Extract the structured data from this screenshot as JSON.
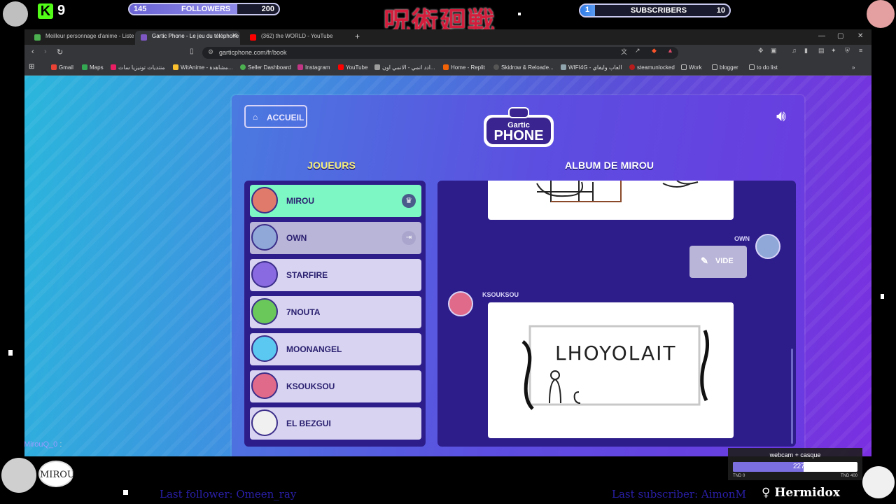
{
  "overlay": {
    "kick_count": "9",
    "followers": {
      "label": "FOLLOWERS",
      "current": "145",
      "goal": "200",
      "progress": 0.725
    },
    "subscribers": {
      "label": "SUBSCRIBERS",
      "current": "1",
      "goal": "10",
      "progress": 0.1
    },
    "title_jp": "呪術廻戦",
    "chat": {
      "user": "MirouQ_0",
      "message": ":"
    },
    "last_follower": "Last follower: Omeen_ray",
    "last_subscriber": "Last subscriber: AimonM",
    "brand": "Hermidox",
    "badge_text": "MIROU",
    "donation_goal": {
      "label": "webcam + casque",
      "current": "227",
      "min": "TND 0",
      "max": "TND 400",
      "progress": 0.5675
    }
  },
  "browser": {
    "tabs": [
      {
        "title": "Meilleur personnage d'anime - Liste",
        "color": "#4caf50"
      },
      {
        "title": "Gartic Phone - Le jeu du téléphone",
        "color": "#7e57c2"
      },
      {
        "title": "(362) the WORLD - YouTube",
        "color": "#ff0000"
      }
    ],
    "url": "garticphone.com/fr/book",
    "bookmarks": [
      {
        "label": "Gmail",
        "color": "#ea4335"
      },
      {
        "label": "Maps",
        "color": "#34a853"
      },
      {
        "label": "منتديات تونيزيا سات",
        "color": "#e91e63"
      },
      {
        "label": "WitAnime - مشاهدة...",
        "color": "#fbc02d"
      },
      {
        "label": "Seller Dashboard",
        "color": "#4caf50"
      },
      {
        "label": "Instagram",
        "color": "#c13584"
      },
      {
        "label": "YouTube",
        "color": "#ff0000"
      },
      {
        "label": "ادد انمي - الانمي اون...",
        "color": "#9e9e9e"
      },
      {
        "label": "Home - Replit",
        "color": "#f26207"
      },
      {
        "label": "Skidrow & Reloade...",
        "color": "#555555"
      },
      {
        "label": "WIFI4G - العاب وايفاي",
        "color": "#90a4ae"
      },
      {
        "label": "steamunlocked",
        "color": "#b71c1c"
      },
      {
        "label": "Work",
        "color": "#9e9e9e"
      },
      {
        "label": "blogger",
        "color": "#9e9e9e"
      },
      {
        "label": "to do list",
        "color": "#9e9e9e"
      }
    ]
  },
  "game": {
    "home_label": "ACCUEIL",
    "logo_top": "Gartic",
    "logo_main": "PHONE",
    "players_title": "JOUEURS",
    "album_title": "ALBUM DE MIROU",
    "players": [
      {
        "name": "MIROU",
        "color": "#e07a6a",
        "state": "host"
      },
      {
        "name": "OWN",
        "color": "#8fa8d8",
        "state": "away"
      },
      {
        "name": "STARFIRE",
        "color": "#8a6ae0",
        "state": "normal"
      },
      {
        "name": "7NOUTA",
        "color": "#6ac85a",
        "state": "normal"
      },
      {
        "name": "MOONANGEL",
        "color": "#5ac8f0",
        "state": "normal"
      },
      {
        "name": "KSOUKSOU",
        "color": "#e06a8a",
        "state": "normal"
      },
      {
        "name": "EL BEZGUI",
        "color": "#f0f0f0",
        "state": "normal"
      }
    ],
    "album": {
      "entry_own": {
        "author": "OWN",
        "button": "VIDE"
      },
      "entry_ksouksou": {
        "author": "KSOUKSOU",
        "drawing_text": "LHOYOLAIT"
      }
    }
  }
}
